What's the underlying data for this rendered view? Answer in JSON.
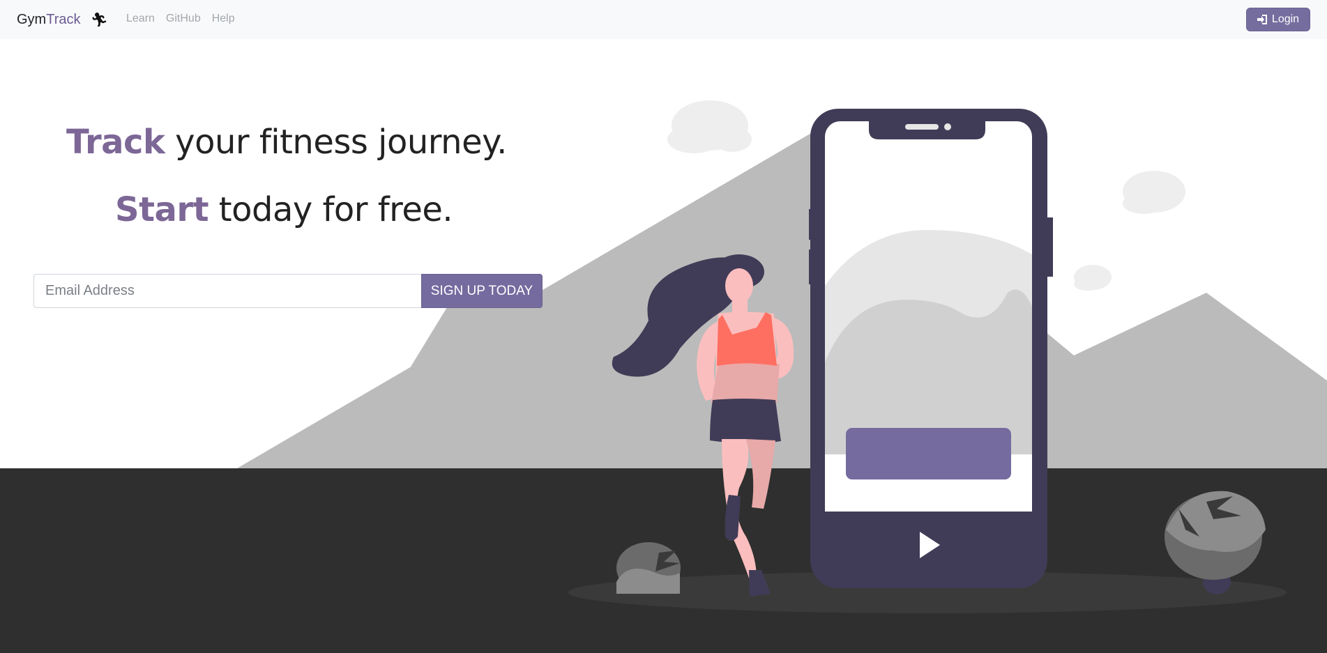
{
  "navbar": {
    "brand_part1": "Gym",
    "brand_part2": "Track",
    "brand_icon": "running-man-icon",
    "links": [
      "Learn",
      "GitHub",
      "Help"
    ],
    "login_label": "Login",
    "login_icon": "sign-in-icon"
  },
  "hero": {
    "line1_accent": "Track",
    "line1_rest": " your fitness journey.",
    "line2_accent": "Start",
    "line2_rest": " today for free."
  },
  "signup": {
    "email_placeholder": "Email Address",
    "button_label": "SIGN UP TODAY"
  },
  "colors": {
    "accent": "#766d9f",
    "headline_accent": "#7c6796",
    "ground": "#2f2f2f",
    "mountains": "#bbbbbb",
    "phone": "#403c57"
  }
}
